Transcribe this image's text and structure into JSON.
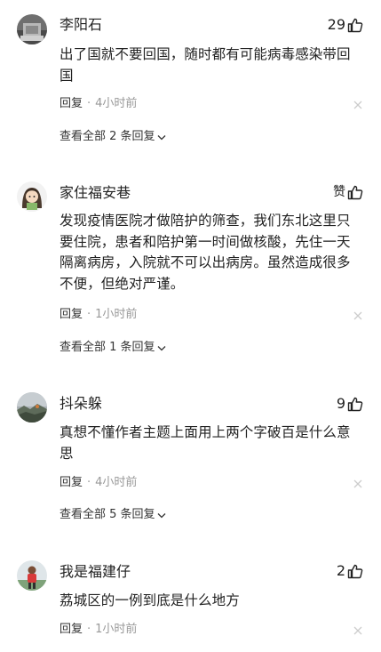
{
  "labels": {
    "reply": "回复",
    "separator": "·"
  },
  "comments": [
    {
      "username": "李阳石",
      "likes": "29",
      "text": "出了国就不要回国，随时都有可能病毒感染带回国",
      "time": "4小时前",
      "view_replies": "查看全部 2 条回复",
      "avatar_icon": "avatar-gray-photo"
    },
    {
      "username": "家住福安巷",
      "likes": "赞",
      "text": "发现疫情医院才做陪护的筛查，我们东北这里只要住院，患者和陪护第一时间做核酸，先住一天隔离病房，入院就不可以出病房。虽然造成很多不便，但绝对严谨。",
      "time": "1小时前",
      "view_replies": "查看全部 1 条回复",
      "avatar_icon": "avatar-cartoon-girl"
    },
    {
      "username": "抖朵躲",
      "likes": "9",
      "text": "真想不懂作者主题上面用上两个字破百是什么意思",
      "time": "4小时前",
      "view_replies": "查看全部 5 条回复",
      "avatar_icon": "avatar-landscape-photo"
    },
    {
      "username": "我是福建仔",
      "likes": "2",
      "text": "荔城区的一例到底是什么地方",
      "time": "1小时前",
      "view_replies": "",
      "avatar_icon": "avatar-person-red"
    }
  ],
  "colors": {
    "text_primary": "#222222",
    "text_secondary": "#999999",
    "close_icon": "#cccccc"
  }
}
